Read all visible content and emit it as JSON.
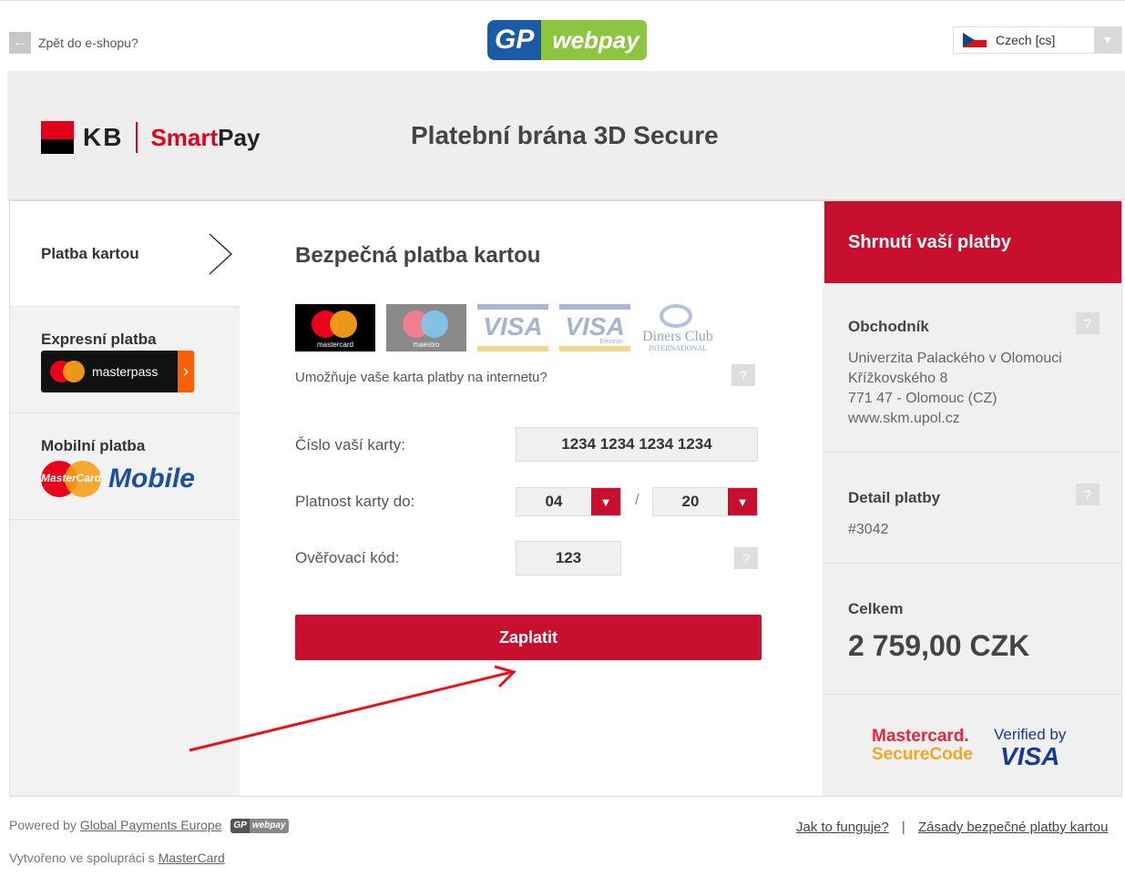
{
  "topbar": {
    "back_label": "Zpět do e-shopu?",
    "logo_gp": "GP",
    "logo_webpay": "webpay",
    "language": "Czech [cs]"
  },
  "header": {
    "kb_text": "KB",
    "smart_text": "Smart",
    "pay_text": "Pay",
    "title": "Platební brána 3D Secure"
  },
  "sidebar": {
    "items": [
      {
        "label": "Platba kartou"
      },
      {
        "label": "Expresní platba",
        "badge": "masterpass"
      },
      {
        "label": "Mobilní platba",
        "badge_logo": "MasterCard",
        "badge_word": "Mobile"
      }
    ]
  },
  "payment": {
    "title": "Bezpečná platba kartou",
    "card_logos": [
      {
        "name": "mastercard",
        "text": "mastercard"
      },
      {
        "name": "maestro",
        "text": "maestro"
      },
      {
        "name": "visa",
        "text": "VISA"
      },
      {
        "name": "visa-electron",
        "text": "VISA",
        "sub": "Electron"
      },
      {
        "name": "diners",
        "text": "Diners Club",
        "sub": "INTERNATIONAL"
      }
    ],
    "internet_question": "Umožňuje vaše karta platby na internetu?",
    "help_symbol": "?",
    "card_number_label": "Číslo vaší karty:",
    "card_number_value": "1234 1234 1234 1234",
    "expiry_label": "Platnost karty do:",
    "expiry_month": "04",
    "expiry_year": "20",
    "expiry_separator": "/",
    "cvc_label": "Ověřovací kód:",
    "cvc_value": "123",
    "pay_button": "Zaplatit"
  },
  "summary": {
    "title": "Shrnutí vaší platby",
    "merchant_label": "Obchodník",
    "merchant_lines": [
      "Univerzita Palackého v Olomouci",
      "Křížkovského 8",
      "771 47 - Olomouc (CZ)",
      "www.skm.upol.cz"
    ],
    "detail_label": "Detail platby",
    "detail_value": "#3042",
    "total_label": "Celkem",
    "total_value": "2 759,00 CZK",
    "securecode_line1": "Mastercard.",
    "securecode_line2": "SecureCode",
    "verified_line1": "Verified by",
    "verified_line2": "VISA"
  },
  "footer": {
    "powered_prefix": "Powered by",
    "powered_link": "Global Payments Europe",
    "mini_gp": "GP",
    "mini_webpay": "webpay",
    "cooperation_prefix": "Vytvořeno ve spolupráci s",
    "cooperation_link": "MasterCard",
    "how_link": "Jak to funguje?",
    "separator": "|",
    "policy_link": "Zásady bezpečné platby kartou"
  },
  "colors": {
    "brand_red": "#c8102e",
    "kb_red": "#e2001a",
    "annotation_arrow": "#e8131a"
  }
}
